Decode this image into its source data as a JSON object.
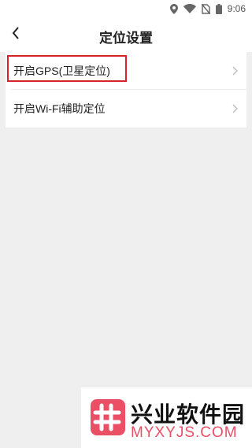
{
  "status_bar": {
    "time": "9:06"
  },
  "header": {
    "title": "定位设置"
  },
  "settings": [
    {
      "label": "开启GPS(卫星定位)"
    },
    {
      "label": "开启Wi-Fi辅助定位"
    }
  ],
  "watermark": {
    "name": "兴业软件园",
    "domain": "MYXYJS.COM"
  },
  "colors": {
    "highlight": "#d9232a",
    "accent": "#ea4f66"
  }
}
